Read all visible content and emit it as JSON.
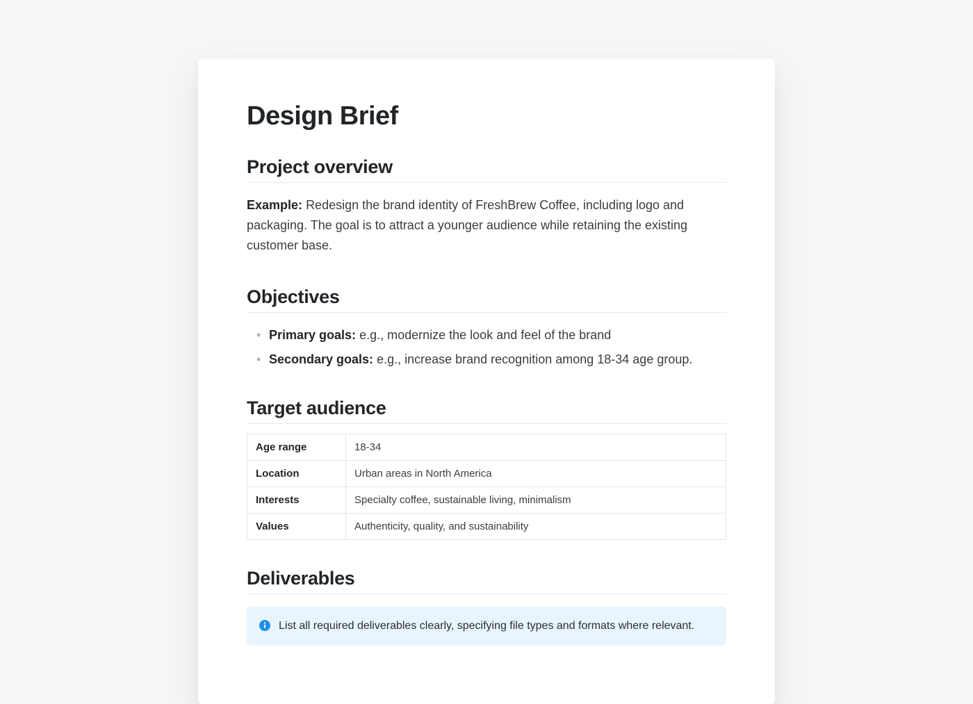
{
  "title": "Design Brief",
  "sections": {
    "overview": {
      "heading": "Project overview",
      "example_label": "Example:",
      "example_text": "Redesign the brand identity of FreshBrew Coffee, including logo and packaging. The goal is to attract a younger audience while retaining the existing customer base."
    },
    "objectives": {
      "heading": "Objectives",
      "items": [
        {
          "label": "Primary goals:",
          "text": "e.g., modernize the look and feel of the brand"
        },
        {
          "label": "Secondary goals:",
          "text": "e.g., increase brand recognition among 18-34 age group."
        }
      ]
    },
    "audience": {
      "heading": "Target audience",
      "rows": [
        {
          "key": "Age range",
          "value": "18-34"
        },
        {
          "key": "Location",
          "value": "Urban areas in North America"
        },
        {
          "key": "Interests",
          "value": "Specialty coffee, sustainable living, minimalism"
        },
        {
          "key": "Values",
          "value": "Authenticity, quality, and sustainability"
        }
      ]
    },
    "deliverables": {
      "heading": "Deliverables",
      "info_text": "List all required deliverables clearly, specifying file types and formats where relevant."
    }
  }
}
